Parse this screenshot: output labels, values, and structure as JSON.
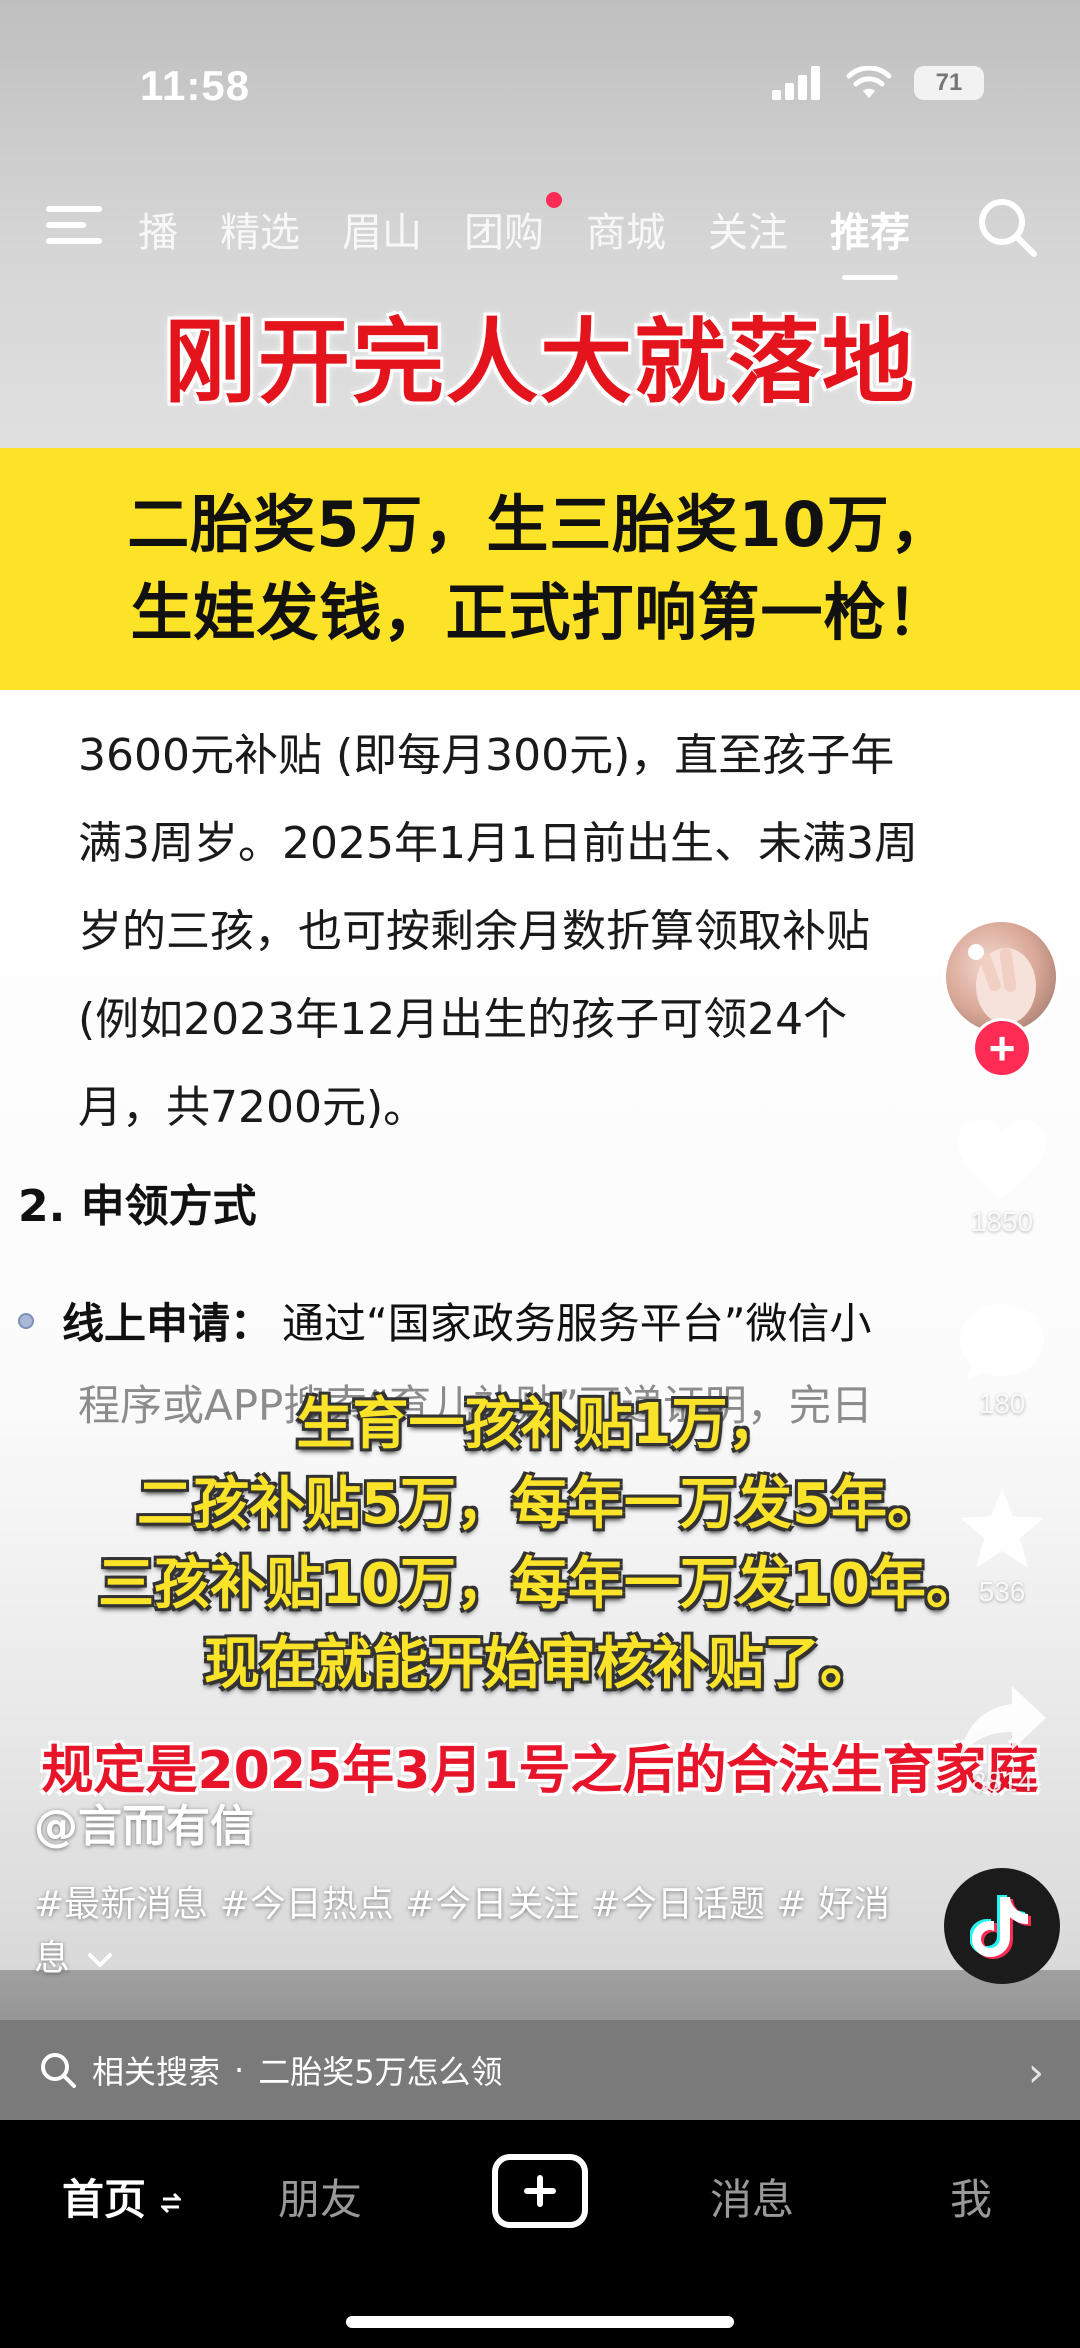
{
  "status_bar": {
    "time": "11:58",
    "battery": "71"
  },
  "top_nav": {
    "tabs": [
      "播",
      "精选",
      "眉山",
      "团购",
      "商城",
      "关注",
      "推荐"
    ],
    "active_tab": "推荐"
  },
  "video": {
    "headline": "刚开完人大就落地",
    "banner_line1": "二胎奖5万，生三胎奖10万，",
    "banner_line2": "生娃发钱，正式打响第一枪！",
    "doc_lines": [
      "3600元补贴 (即每月300元)，直至孩子年",
      "满3周岁。2025年1月1日前出生、未满3周",
      "岁的三孩，也可按剩余月数折算领取补贴",
      "(例如2023年12月出生的孩子可领24个",
      "月，共7200元)。"
    ],
    "section_title": "2.  申领方式",
    "bullet_strong": "线上申请：",
    "bullet_text": "通过“国家政务服务平台”微信小",
    "faded_line": "程序或APP搜索“育儿补贴”可递证明，完日",
    "subtitles": [
      "生育一孩补贴1万，",
      "二孩补贴5万，每年一万发5年。",
      "三孩补贴10万，每年一万发10年。",
      "现在就能开始审核补贴了。"
    ],
    "red_caption": "规定是2025年3月1号之后的合法生育家庭"
  },
  "actions": {
    "likes": "1850",
    "comments": "180",
    "favorites": "536",
    "shares": "8814"
  },
  "author": "@言而有信",
  "hashtags": "#最新消息 #今日热点 #今日关注 #今日话题 # 好消息",
  "related_search": {
    "label": "相关搜索",
    "separator": "·",
    "query": "二胎奖5万怎么领"
  },
  "bottom_tabs": {
    "home": "首页",
    "friends": "朋友",
    "messages": "消息",
    "me": "我"
  },
  "colors": {
    "accent": "#fe2c55",
    "headline_red": "#e4141c",
    "banner_yellow": "#fde327",
    "subtitle_yellow": "#fbe329"
  },
  "icons": [
    "menu-icon",
    "search-icon",
    "heart-icon",
    "comment-icon",
    "star-icon",
    "share-icon",
    "douyin-logo-icon",
    "plus-icon",
    "chevron-right-icon",
    "swap-icon",
    "chevron-down-icon",
    "signal-icon",
    "wifi-icon",
    "battery-icon"
  ]
}
